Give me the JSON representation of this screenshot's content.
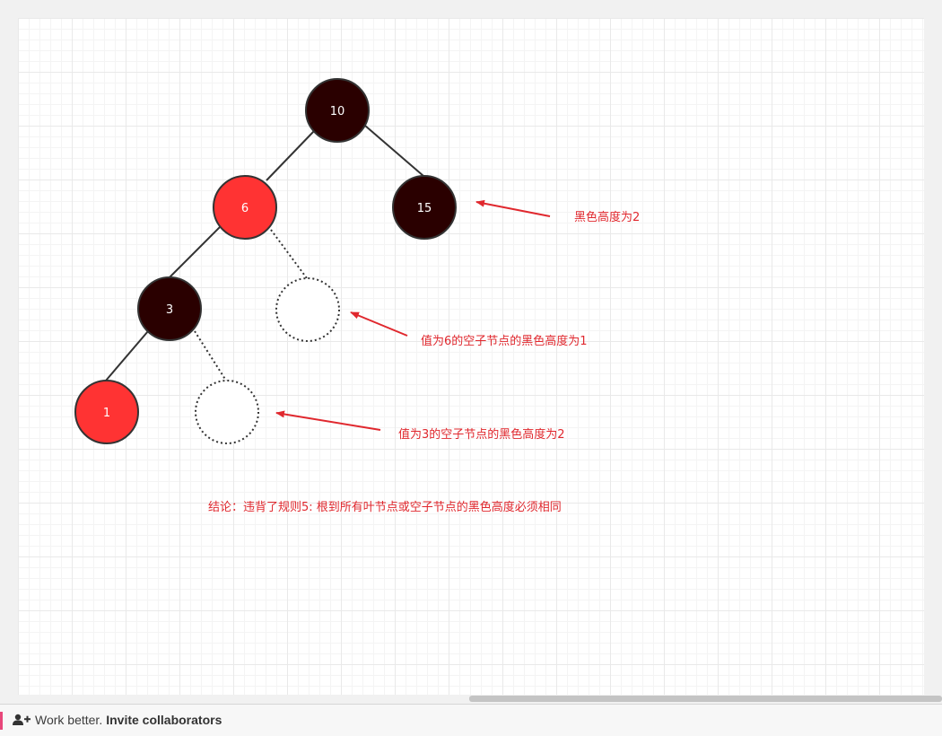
{
  "diagram": {
    "nodes": [
      {
        "id": "n10",
        "label": "10",
        "color": "black"
      },
      {
        "id": "n6",
        "label": "6",
        "color": "red"
      },
      {
        "id": "n15",
        "label": "15",
        "color": "black"
      },
      {
        "id": "n3",
        "label": "3",
        "color": "black"
      },
      {
        "id": "nil6",
        "label": "",
        "color": "nil"
      },
      {
        "id": "n1",
        "label": "1",
        "color": "red"
      },
      {
        "id": "nil3",
        "label": "",
        "color": "nil"
      }
    ],
    "edges": [
      {
        "from": "n10",
        "to": "n6",
        "style": "solid"
      },
      {
        "from": "n10",
        "to": "n15",
        "style": "solid"
      },
      {
        "from": "n6",
        "to": "n3",
        "style": "solid"
      },
      {
        "from": "n6",
        "to": "nil6",
        "style": "dotted"
      },
      {
        "from": "n3",
        "to": "n1",
        "style": "solid"
      },
      {
        "from": "n3",
        "to": "nil3",
        "style": "dotted"
      }
    ],
    "annotations": {
      "n15_height": "黑色高度为2",
      "nil6_height": "值为6的空子节点的黑色高度为1",
      "nil3_height": "值为3的空子节点的黑色高度为2",
      "conclusion": "结论：违背了规则5: 根到所有叶节点或空子节点的黑色高度必须相同"
    },
    "colors": {
      "black_node": "#2a0000",
      "red_node": "#ff3333",
      "annotation": "#e0282e"
    }
  },
  "footer": {
    "text": "Work better.",
    "link": "Invite collaborators",
    "icon": "add-user-icon"
  }
}
